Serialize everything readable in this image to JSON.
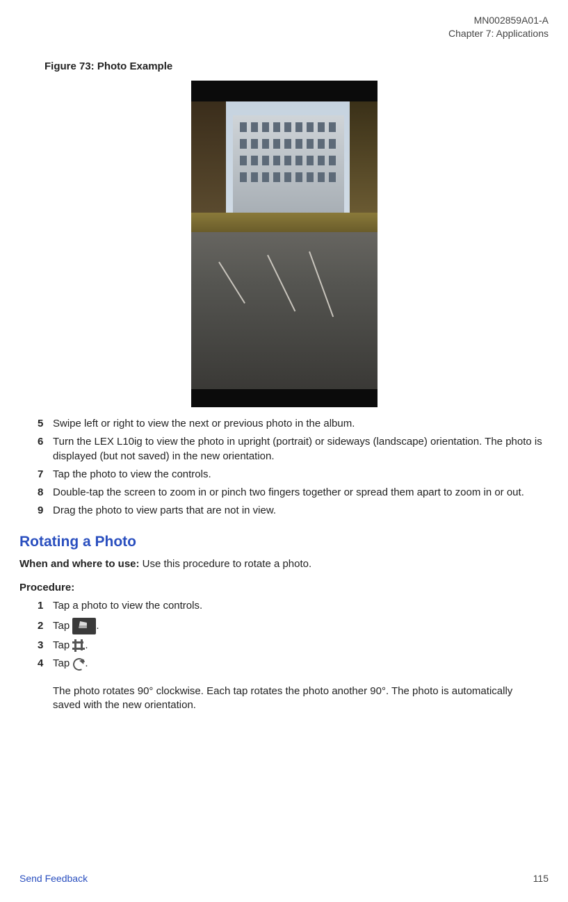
{
  "header": {
    "doc_id": "MN002859A01-A",
    "chapter": "Chapter 7:  Applications"
  },
  "figure": {
    "caption": "Figure 73: Photo Example"
  },
  "stepsA": [
    {
      "n": "5",
      "t": "Swipe left or right to view the next or previous photo in the album."
    },
    {
      "n": "6",
      "t": "Turn the LEX L10ig to view the photo in upright (portrait) or sideways (landscape) orientation. The photo is displayed (but not saved) in the new orientation."
    },
    {
      "n": "7",
      "t": "Tap the photo to view the controls."
    },
    {
      "n": "8",
      "t": "Double-tap the screen to zoom in or pinch two fingers together or spread them apart to zoom in or out."
    },
    {
      "n": "9",
      "t": "Drag the photo to view parts that are not in view."
    }
  ],
  "section": {
    "title": "Rotating a Photo",
    "when_label": "When and where to use:",
    "when_text": " Use this procedure to rotate a photo.",
    "proc_label": "Procedure:"
  },
  "stepsB": {
    "s1": {
      "n": "1",
      "t": "Tap a photo to view the controls."
    },
    "s2": {
      "n": "2",
      "pre": "Tap ",
      "post": "."
    },
    "s3": {
      "n": "3",
      "pre": "Tap ",
      "post": "."
    },
    "s4": {
      "n": "4",
      "pre": "Tap ",
      "post": "."
    },
    "note": "The photo rotates 90° clockwise. Each tap rotates the photo another 90°. The photo is automatically saved with the new orientation."
  },
  "footer": {
    "link": "Send Feedback",
    "page": "115"
  }
}
